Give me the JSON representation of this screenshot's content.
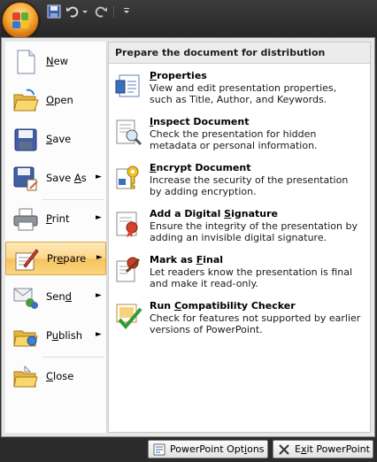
{
  "quick_access": {
    "office_button": "office-button",
    "save": "save-icon",
    "undo": "undo-icon",
    "redo": "redo-icon",
    "customize": "customize-icon"
  },
  "menu": {
    "items": [
      {
        "key": "new",
        "pre": "",
        "u": "N",
        "post": "ew",
        "icon": "new-document-icon",
        "arrow": false
      },
      {
        "key": "open",
        "pre": "",
        "u": "O",
        "post": "pen",
        "icon": "open-folder-icon",
        "arrow": false
      },
      {
        "key": "save",
        "pre": "",
        "u": "S",
        "post": "ave",
        "icon": "save-disk-icon",
        "arrow": false
      },
      {
        "key": "save-as",
        "pre": "Save ",
        "u": "A",
        "post": "s",
        "icon": "save-as-icon",
        "arrow": true
      },
      {
        "key": "print",
        "pre": "",
        "u": "P",
        "post": "rint",
        "icon": "printer-icon",
        "arrow": true
      },
      {
        "key": "prepare",
        "pre": "Pr",
        "u": "e",
        "post": "pare",
        "icon": "prepare-icon",
        "arrow": true
      },
      {
        "key": "send",
        "pre": "Sen",
        "u": "d",
        "post": "",
        "icon": "send-icon",
        "arrow": true
      },
      {
        "key": "publish",
        "pre": "P",
        "u": "u",
        "post": "blish",
        "icon": "publish-icon",
        "arrow": true
      },
      {
        "key": "close",
        "pre": "",
        "u": "C",
        "post": "lose",
        "icon": "close-folder-icon",
        "arrow": false
      }
    ],
    "arrow_glyph": "►"
  },
  "prepare_panel": {
    "header": "Prepare the document for distribution",
    "items": [
      {
        "key": "properties",
        "pre": "",
        "u": "P",
        "post": "roperties",
        "desc": "View and edit presentation properties, such as Title, Author, and Keywords.",
        "icon": "properties-icon"
      },
      {
        "key": "inspect",
        "pre": "",
        "u": "I",
        "post": "nspect Document",
        "desc": "Check the presentation for hidden metadata or personal information.",
        "icon": "inspect-document-icon"
      },
      {
        "key": "encrypt",
        "pre": "",
        "u": "E",
        "post": "ncrypt Document",
        "desc": "Increase the security of the presentation by adding encryption.",
        "icon": "encrypt-key-icon"
      },
      {
        "key": "signature",
        "pre": "Add a Digital ",
        "u": "S",
        "post": "ignature",
        "desc": "Ensure the integrity of the presentation by adding an invisible digital signature.",
        "icon": "digital-signature-icon"
      },
      {
        "key": "mark-final",
        "pre": "Mark as ",
        "u": "F",
        "post": "inal",
        "desc": "Let readers know the presentation is final and make it read-only.",
        "icon": "mark-final-icon"
      },
      {
        "key": "compat",
        "pre": "Run ",
        "u": "C",
        "post": "ompatibility Checker",
        "desc": "Check for features not supported by earlier versions of PowerPoint.",
        "icon": "compatibility-checker-icon"
      }
    ]
  },
  "bottom": {
    "options": {
      "pre": "PowerPoint Opt",
      "u": "i",
      "post": "ons"
    },
    "exit": {
      "pre": "E",
      "u": "x",
      "post": "it PowerPoint"
    }
  },
  "colors": {
    "highlight": "#fbd78b",
    "frame": "#2b2b2b"
  }
}
